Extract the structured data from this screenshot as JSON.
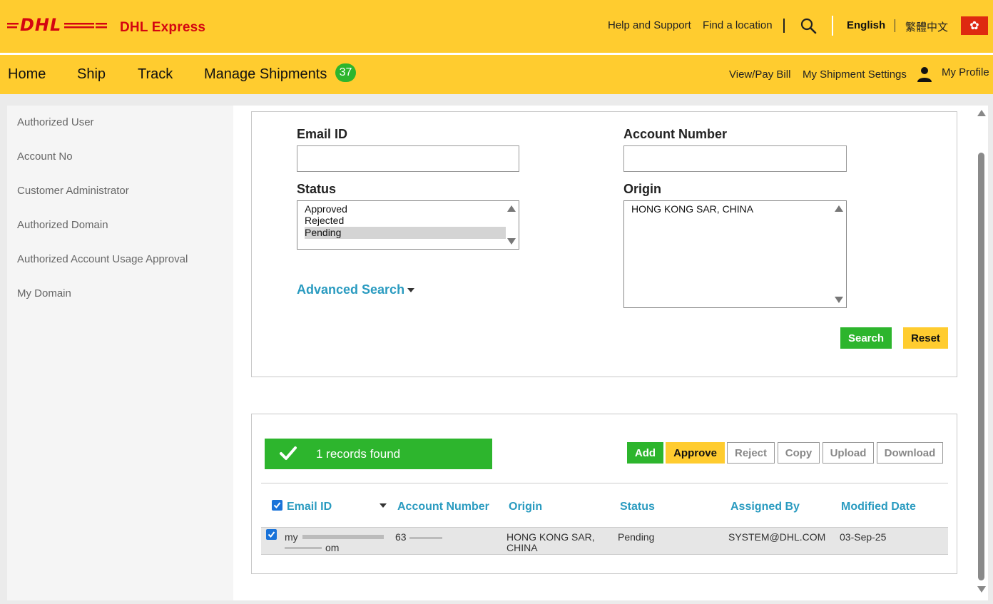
{
  "header": {
    "brand": "DHL Express",
    "links": {
      "help": "Help and Support",
      "locate": "Find a location"
    },
    "languages": {
      "english": "English",
      "chinese": "繁體中文"
    }
  },
  "nav": {
    "home": "Home",
    "ship": "Ship",
    "track": "Track",
    "manage": "Manage Shipments",
    "badge_count": "37",
    "view_pay_bill": "View/Pay Bill",
    "shipment_settings": "My Shipment Settings",
    "my_profile": "My Profile"
  },
  "sidebar": {
    "items": [
      {
        "label": "Authorized User"
      },
      {
        "label": "Account No"
      },
      {
        "label": "Customer Administrator"
      },
      {
        "label": "Authorized Domain"
      },
      {
        "label": "Authorized Account Usage Approval"
      },
      {
        "label": "My Domain"
      }
    ]
  },
  "filters": {
    "email_label": "Email ID",
    "email_value": "",
    "account_label": "Account Number",
    "account_value": "",
    "status_label": "Status",
    "status_options": [
      "Approved",
      "Rejected",
      "Pending"
    ],
    "status_selected": "Pending",
    "origin_label": "Origin",
    "origin_options": [
      "HONG KONG SAR, CHINA"
    ],
    "advanced_search": "Advanced Search",
    "search_button": "Search",
    "reset_button": "Reset"
  },
  "results": {
    "records_found": "1 records found",
    "actions": {
      "add": "Add",
      "approve": "Approve",
      "reject": "Reject",
      "copy": "Copy",
      "upload": "Upload",
      "download": "Download"
    },
    "columns": {
      "email": "Email ID",
      "account": "Account Number",
      "origin": "Origin",
      "status": "Status",
      "assigned_by": "Assigned By",
      "modified": "Modified Date"
    },
    "rows": [
      {
        "email_start": "my",
        "email_end": "om",
        "account": "63",
        "origin_line1": "HONG KONG SAR,",
        "origin_line2": "CHINA",
        "status": "Pending",
        "assigned_by": "SYSTEM@DHL.COM",
        "modified": "03-Sep-25"
      }
    ]
  }
}
